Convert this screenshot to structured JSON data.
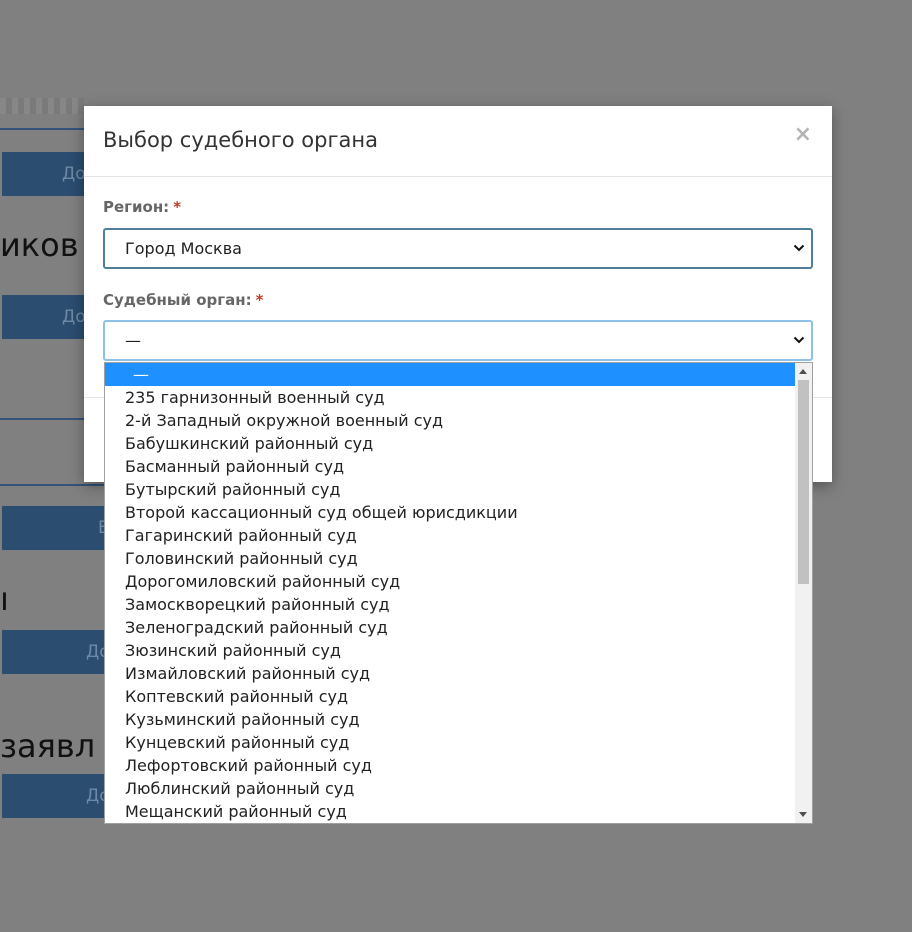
{
  "background": {
    "buttons": [
      "До",
      "До",
      "В",
      "До",
      "До"
    ],
    "texts": [
      "иков",
      "ı",
      "заявл"
    ]
  },
  "modal": {
    "title": "Выбор судебного органа",
    "close": "×",
    "region": {
      "label": "Регион:",
      "required": "*",
      "value": "Город Москва"
    },
    "court": {
      "label": "Судебный орган:",
      "required": "*",
      "value": "—"
    }
  },
  "dropdown": {
    "options": [
      "—",
      "235 гарнизонный военный суд",
      "2-й Западный окружной военный суд",
      "Бабушкинский районный суд",
      "Басманный районный суд",
      "Бутырский районный суд",
      "Второй кассационный суд общей юрисдикции",
      "Гагаринский районный суд",
      "Головинский районный суд",
      "Дорогомиловский районный суд",
      "Замоскворецкий районный суд",
      "Зеленоградский районный суд",
      "Зюзинский районный суд",
      "Измайловский районный суд",
      "Коптевский районный суд",
      "Кузьминский районный суд",
      "Кунцевский районный суд",
      "Лефортовский районный суд",
      "Люблинский районный суд",
      "Мещанский районный суд"
    ],
    "selected_index": 0
  },
  "colors": {
    "overlay": "#808080",
    "accent_border": "#4f7f9a",
    "focus_border": "#8fc1e8",
    "selected_bg": "#1e90ff",
    "required": "#c0392b"
  }
}
